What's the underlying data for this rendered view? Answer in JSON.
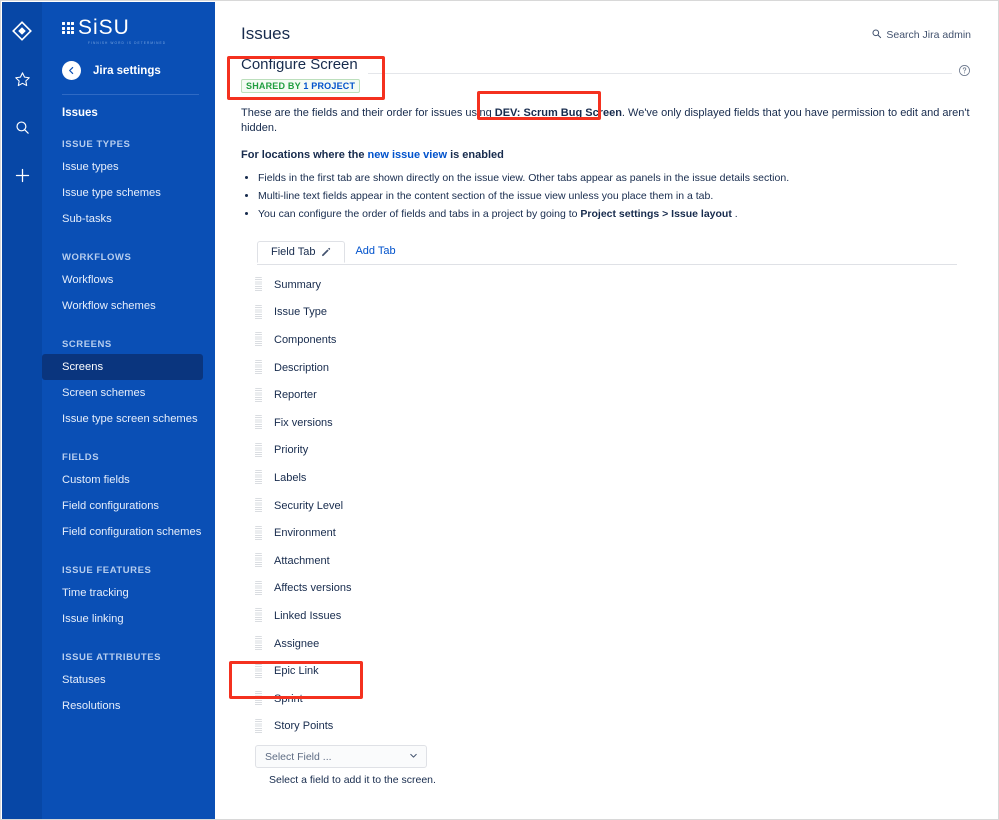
{
  "rail": {
    "icons": [
      {
        "name": "jira-logo-icon"
      },
      {
        "name": "star-icon"
      },
      {
        "name": "search-icon"
      },
      {
        "name": "add-icon"
      }
    ]
  },
  "sidebar": {
    "logo_text": "SiSU",
    "logo_tagline": "FINNISH WORD IS DETERMINED",
    "back_label": "Jira settings",
    "top_item": "Issues",
    "groups": [
      {
        "heading": "ISSUE TYPES",
        "items": [
          {
            "label": "Issue types",
            "active": false
          },
          {
            "label": "Issue type schemes",
            "active": false
          },
          {
            "label": "Sub-tasks",
            "active": false
          }
        ]
      },
      {
        "heading": "WORKFLOWS",
        "items": [
          {
            "label": "Workflows",
            "active": false
          },
          {
            "label": "Workflow schemes",
            "active": false
          }
        ]
      },
      {
        "heading": "SCREENS",
        "items": [
          {
            "label": "Screens",
            "active": true
          },
          {
            "label": "Screen schemes",
            "active": false
          },
          {
            "label": "Issue type screen schemes",
            "active": false
          }
        ]
      },
      {
        "heading": "FIELDS",
        "items": [
          {
            "label": "Custom fields",
            "active": false
          },
          {
            "label": "Field configurations",
            "active": false
          },
          {
            "label": "Field configuration schemes",
            "active": false
          }
        ]
      },
      {
        "heading": "ISSUE FEATURES",
        "items": [
          {
            "label": "Time tracking",
            "active": false
          },
          {
            "label": "Issue linking",
            "active": false
          }
        ]
      },
      {
        "heading": "ISSUE ATTRIBUTES",
        "items": [
          {
            "label": "Statuses",
            "active": false
          },
          {
            "label": "Resolutions",
            "active": false
          }
        ]
      }
    ]
  },
  "header": {
    "page_title": "Issues",
    "search_admin_label": "Search Jira admin",
    "help_label": "?"
  },
  "screen": {
    "title": "Configure Screen",
    "badge_prefix": "SHARED BY",
    "badge_count": "1 PROJECT",
    "desc_before": "These are the fields and their order for issues using",
    "screen_name": "DEV: Scrum Bug Screen",
    "desc_after": ". We've only displayed fields that you have permission to edit and aren't hidden.",
    "sub_head_before": "For locations where the",
    "sub_head_link": "new issue view",
    "sub_head_after": "is enabled",
    "notes": [
      "Fields in the first tab are shown directly on the issue view. Other tabs appear as panels in the issue details section.",
      "Multi-line text fields appear in the content section of the issue view unless you place them in a tab.",
      "You can configure the order of fields and tabs in a project by going to Project settings > Issue layout ."
    ],
    "note3_before": "You can configure the order of fields and tabs in a project by going to",
    "note3_bold": "Project settings > Issue layout",
    "note3_after": "."
  },
  "tabs": {
    "field_tab_label": "Field Tab",
    "add_tab_label": "Add Tab"
  },
  "fields": [
    {
      "label": "Summary"
    },
    {
      "label": "Issue Type"
    },
    {
      "label": "Components"
    },
    {
      "label": "Description"
    },
    {
      "label": "Reporter"
    },
    {
      "label": "Fix versions"
    },
    {
      "label": "Priority"
    },
    {
      "label": "Labels"
    },
    {
      "label": "Security Level"
    },
    {
      "label": "Environment"
    },
    {
      "label": "Attachment"
    },
    {
      "label": "Affects versions"
    },
    {
      "label": "Linked Issues"
    },
    {
      "label": "Assignee"
    },
    {
      "label": "Epic Link"
    },
    {
      "label": "Sprint"
    },
    {
      "label": "Story Points"
    }
  ],
  "add_field": {
    "select_value": "Select Field ...",
    "hint": "Select a field to add it to the screen."
  },
  "colors": {
    "brand_blue": "#0a4fb5",
    "rail_blue": "#0747a6",
    "active_item": "#0a357e",
    "link_blue": "#0052cc",
    "annotation_red": "#f4311f",
    "badge_green": "#1f9d3f",
    "text": "#172b4d"
  }
}
